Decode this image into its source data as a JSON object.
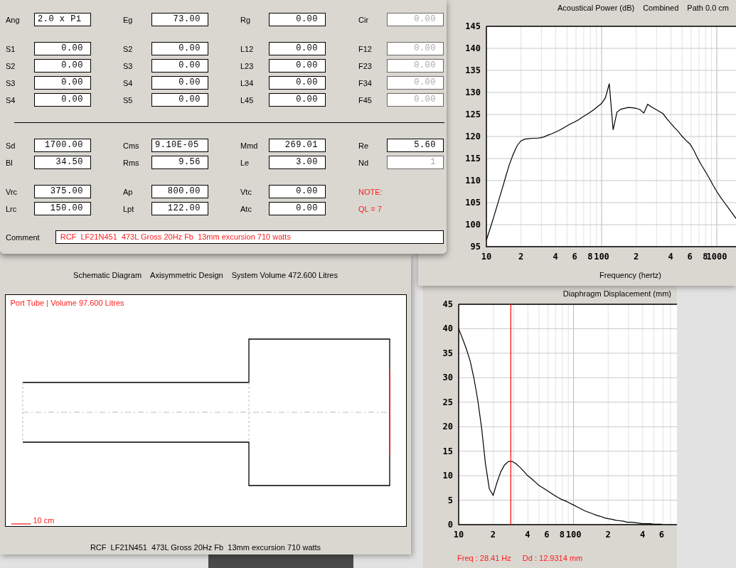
{
  "parameters": {
    "sections": [
      [
        [
          [
            {
              "kind": "text",
              "label": "Ang",
              "value": "2.0 x Pi",
              "disabled": false
            },
            {
              "kind": "number",
              "label": "Eg",
              "value": "73.00",
              "disabled": false
            },
            {
              "kind": "number",
              "label": "Rg",
              "value": "0.00",
              "disabled": false
            },
            {
              "kind": "number",
              "label": "Cir",
              "value": "0.00",
              "disabled": true
            }
          ]
        ],
        [
          [
            {
              "kind": "number",
              "label": "S1",
              "value": "0.00",
              "disabled": false
            },
            {
              "kind": "number",
              "label": "S2",
              "value": "0.00",
              "disabled": false
            },
            {
              "kind": "number",
              "label": "L12",
              "value": "0.00",
              "disabled": false
            },
            {
              "kind": "number",
              "label": "F12",
              "value": "0.00",
              "disabled": true
            }
          ],
          [
            {
              "kind": "number",
              "label": "S2",
              "value": "0.00",
              "disabled": false
            },
            {
              "kind": "number",
              "label": "S3",
              "value": "0.00",
              "disabled": false
            },
            {
              "kind": "number",
              "label": "L23",
              "value": "0.00",
              "disabled": false
            },
            {
              "kind": "number",
              "label": "F23",
              "value": "0.00",
              "disabled": true
            }
          ],
          [
            {
              "kind": "number",
              "label": "S3",
              "value": "0.00",
              "disabled": false
            },
            {
              "kind": "number",
              "label": "S4",
              "value": "0.00",
              "disabled": false
            },
            {
              "kind": "number",
              "label": "L34",
              "value": "0.00",
              "disabled": false
            },
            {
              "kind": "number",
              "label": "F34",
              "value": "0.00",
              "disabled": true
            }
          ],
          [
            {
              "kind": "number",
              "label": "S4",
              "value": "0.00",
              "disabled": false
            },
            {
              "kind": "number",
              "label": "S5",
              "value": "0.00",
              "disabled": false
            },
            {
              "kind": "number",
              "label": "L45",
              "value": "0.00",
              "disabled": false
            },
            {
              "kind": "number",
              "label": "F45",
              "value": "0.00",
              "disabled": true
            }
          ]
        ]
      ],
      [
        [
          [
            {
              "kind": "number",
              "label": "Sd",
              "value": "1700.00",
              "disabled": false
            },
            {
              "kind": "text",
              "label": "Cms",
              "value": "9.10E-05",
              "disabled": false
            },
            {
              "kind": "number",
              "label": "Mmd",
              "value": "269.01",
              "disabled": false
            },
            {
              "kind": "number",
              "label": "Re",
              "value": "5.60",
              "disabled": false
            }
          ],
          [
            {
              "kind": "number",
              "label": "Bl",
              "value": "34.50",
              "disabled": false
            },
            {
              "kind": "number",
              "label": "Rms",
              "value": "9.56",
              "disabled": false
            },
            {
              "kind": "number",
              "label": "Le",
              "value": "3.00",
              "disabled": false
            },
            {
              "kind": "number",
              "label": "Nd",
              "value": "1",
              "disabled": true
            }
          ]
        ],
        [
          [
            {
              "kind": "number",
              "label": "Vrc",
              "value": "375.00",
              "disabled": false
            },
            {
              "kind": "number",
              "label": "Ap",
              "value": "800.00",
              "disabled": false
            },
            {
              "kind": "number",
              "label": "Vtc",
              "value": "0.00",
              "disabled": false
            },
            {
              "kind": "note",
              "text": "NOTE:"
            }
          ],
          [
            {
              "kind": "number",
              "label": "Lrc",
              "value": "150.00",
              "disabled": false
            },
            {
              "kind": "number",
              "label": "Lpt",
              "value": "122.00",
              "disabled": false
            },
            {
              "kind": "number",
              "label": "Atc",
              "value": "0.00",
              "disabled": false
            },
            {
              "kind": "note",
              "text": "QL = 7"
            }
          ]
        ]
      ]
    ],
    "comment": {
      "label": "Comment",
      "value": "RCF  LF21N451  473L Gross 20Hz Fb  13mm excursion 710 watts"
    }
  },
  "power_window": {
    "header_extra": [
      "Combined",
      "Path 0.0 cm"
    ],
    "chart_data": {
      "type": "line",
      "title": "Acoustical Power (dB)",
      "xlabel": "Frequency (hertz)",
      "grid": true,
      "ylim": [
        95,
        145
      ],
      "yticks": [
        95,
        100,
        105,
        110,
        115,
        120,
        125,
        130,
        135,
        140,
        145
      ],
      "categories": [
        "10",
        null,
        null,
        null,
        null,
        null,
        null,
        null,
        null,
        "2",
        null,
        null,
        null,
        null,
        null,
        null,
        null,
        null,
        "4",
        null,
        null,
        null,
        null,
        "6",
        null,
        null,
        null,
        "8",
        null,
        null,
        "100",
        null,
        null,
        null,
        null,
        null,
        null,
        null,
        null,
        "2",
        null,
        null,
        null,
        null,
        null,
        null,
        null,
        null,
        "4",
        null,
        null,
        null,
        null,
        "6",
        null,
        null,
        null,
        "8",
        null,
        null,
        "1000",
        null,
        null,
        null,
        null,
        null
      ],
      "series": [
        {
          "color": "#000000",
          "values": [
            96.5,
            99.2,
            102,
            104.9,
            107.8,
            110.8,
            113.7,
            116,
            117.9,
            119,
            119.4,
            119.5,
            119.6,
            119.6,
            119.7,
            119.9,
            120.3,
            120.6,
            121,
            121.4,
            121.9,
            122.4,
            122.9,
            123.3,
            123.8,
            124.4,
            124.9,
            125.5,
            126.1,
            126.8,
            127.5,
            128.8,
            132,
            121.5,
            125.5,
            126.2,
            126.4,
            126.6,
            126.5,
            126.4,
            126.1,
            125.3,
            127.3,
            126.7,
            126.2,
            125.7,
            125.2,
            124,
            123,
            122,
            121.1,
            120,
            119.1,
            118.3,
            116.9,
            115.1,
            113.5,
            112.1,
            110.6,
            109,
            107.5,
            106.2,
            105,
            103.8,
            102.6,
            101.4
          ]
        }
      ]
    }
  },
  "schematic": {
    "title_parts": [
      "Schematic Diagram",
      "Axisymmetric Design",
      "System Volume 472.600 Litres"
    ],
    "canvas_label": "Port Tube | Volume 97.600 Litres",
    "scale_label": "10 cm",
    "footer": "RCF  LF21N451  473L Gross 20Hz Fb  13mm excursion 710 watts"
  },
  "displacement_window": {
    "readouts": [
      "Freq : 28.41 Hz",
      "Dd : 12.9314 mm"
    ],
    "chart_data": {
      "type": "line",
      "title": "Diaphragm Displacement (mm)",
      "grid": true,
      "ylim": [
        0,
        45
      ],
      "yticks": [
        0,
        5,
        10,
        15,
        20,
        25,
        30,
        35,
        40,
        45
      ],
      "categories": [
        "10",
        null,
        null,
        null,
        null,
        null,
        null,
        null,
        null,
        "2",
        null,
        null,
        null,
        null,
        null,
        null,
        null,
        null,
        "4",
        null,
        null,
        null,
        null,
        "6",
        null,
        null,
        null,
        "8",
        null,
        null,
        "100",
        null,
        null,
        null,
        null,
        null,
        null,
        null,
        null,
        "2",
        null,
        null,
        null,
        null,
        null,
        null,
        null,
        null,
        "4",
        null,
        null,
        null,
        null,
        "6",
        null,
        null,
        null,
        null
      ],
      "series": [
        {
          "color": "#000000",
          "values": [
            40,
            38,
            35.9,
            33.4,
            29.9,
            25.4,
            19.7,
            12.4,
            7.3,
            6,
            8.6,
            10.8,
            12.2,
            12.9,
            12.9,
            12.4,
            11.7,
            10.9,
            10,
            9.4,
            8.7,
            8,
            7.5,
            7,
            6.5,
            6,
            5.5,
            5.1,
            4.8,
            4.4,
            4,
            3.6,
            3.2,
            2.8,
            2.5,
            2.2,
            1.9,
            1.7,
            1.4,
            1.2,
            1.1,
            0.9,
            0.8,
            0.7,
            0.5,
            0.5,
            0.4,
            0.3,
            0.2,
            0.2,
            0.2,
            0.1,
            0.1,
            0.1,
            null,
            null,
            null,
            null
          ]
        }
      ]
    }
  }
}
